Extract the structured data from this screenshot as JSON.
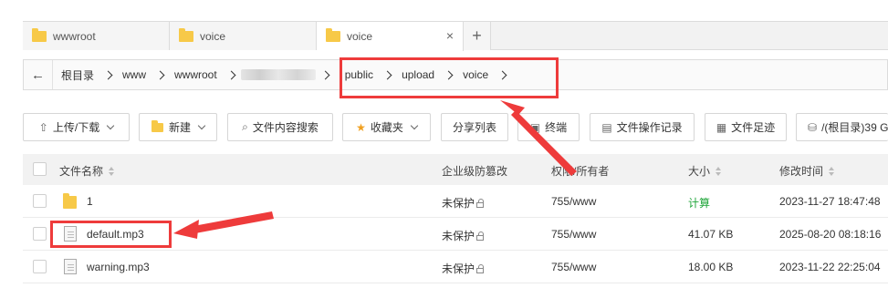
{
  "tabs": [
    {
      "label": "wwwroot"
    },
    {
      "label": "voice"
    },
    {
      "label": "voice"
    }
  ],
  "tab_close": "×",
  "tab_add": "+",
  "breadcrumb": {
    "back": "←",
    "items": [
      "根目录",
      "www",
      "wwwroot",
      "public",
      "upload",
      "voice"
    ]
  },
  "toolbar": {
    "upload_download": "上传/下载",
    "new": "新建",
    "content_search": "文件内容搜索",
    "favorites": "收藏夹",
    "share_list": "分享列表",
    "terminal": "终端",
    "file_log": "文件操作记录",
    "file_footprint": "文件足迹",
    "root_disk": "/(根目录)39 G"
  },
  "table": {
    "headers": {
      "name": "文件名称",
      "tamper": "企业级防篡改",
      "perm": "权限/所有者",
      "size": "大小",
      "mtime": "修改时间"
    },
    "rows": [
      {
        "name": "1",
        "type": "folder",
        "tamper": "未保护",
        "perm": "755/www",
        "size": "计算",
        "mtime": "2023-11-27 18:47:48"
      },
      {
        "name": "default.mp3",
        "type": "file",
        "tamper": "未保护",
        "perm": "755/www",
        "size": "41.07 KB",
        "mtime": "2025-08-20 08:18:16"
      },
      {
        "name": "warning.mp3",
        "type": "file",
        "tamper": "未保护",
        "perm": "755/www",
        "size": "18.00 KB",
        "mtime": "2023-11-22 22:25:04"
      }
    ]
  },
  "colors": {
    "accent_green": "#20a53a",
    "annotation_red": "#ee3b3b",
    "folder_yellow": "#f7c948"
  }
}
